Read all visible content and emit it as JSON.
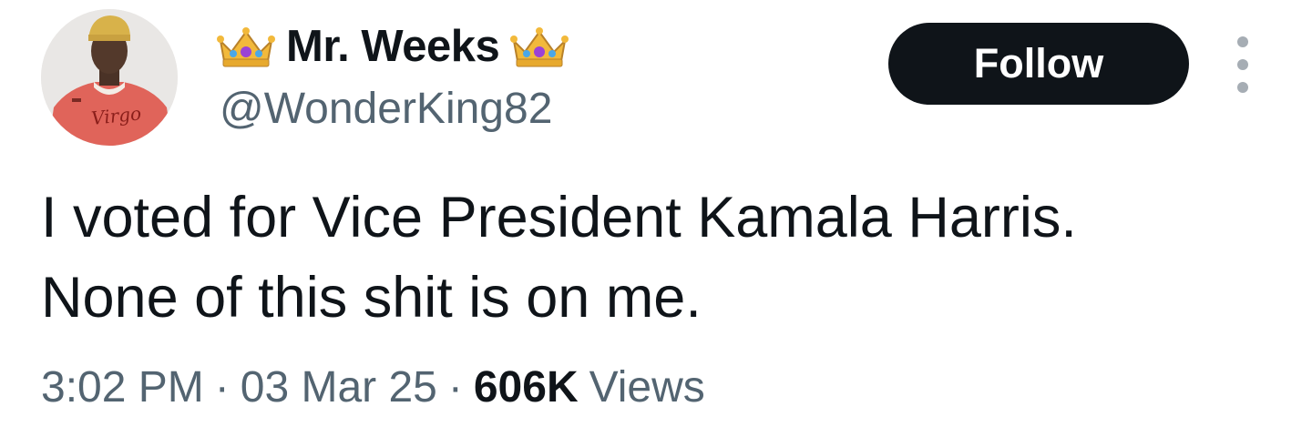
{
  "user": {
    "display_name": "Mr. Weeks",
    "handle": "@WonderKing82",
    "avatar_shirt_text": "Virgo",
    "name_emoji": "crown-emoji"
  },
  "actions": {
    "follow_label": "Follow",
    "more_icon": "more-vertical-icon"
  },
  "tweet": {
    "lines": [
      "I voted for Vice President Kamala Harris.",
      "None of this shit is on me."
    ],
    "time": "3:02 PM",
    "date": "03 Mar 25",
    "separator": "·",
    "views_count": "606K",
    "views_label": "Views"
  },
  "colors": {
    "text_primary": "#0f1419",
    "text_secondary": "#536471",
    "follow_bg": "#0f1419",
    "follow_text": "#ffffff"
  }
}
